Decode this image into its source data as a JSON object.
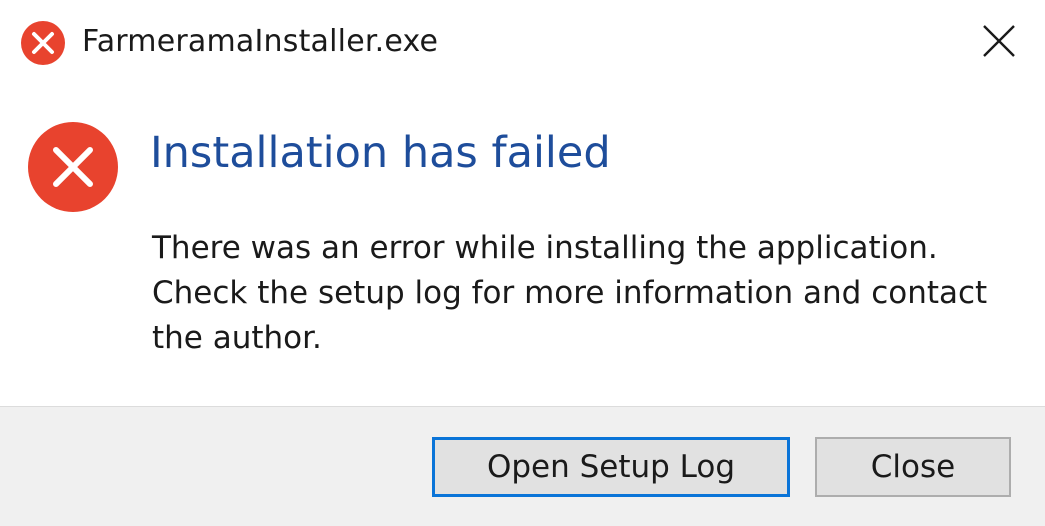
{
  "window": {
    "title": "FarmeramaInstaller.exe",
    "title_icon": "error-icon",
    "close_icon": "close-icon"
  },
  "message": {
    "icon": "error-icon",
    "heading": "Installation has failed",
    "lines": [
      "There was an error while installing the application.",
      "Check the setup log for more information and contact",
      "the author."
    ]
  },
  "buttons": {
    "open_log": "Open Setup Log",
    "close": "Close"
  },
  "colors": {
    "error_red": "#e8432e",
    "heading_blue": "#1e4d9b",
    "focus_blue": "#0a74d8",
    "footer_bg": "#f0f0f0"
  }
}
